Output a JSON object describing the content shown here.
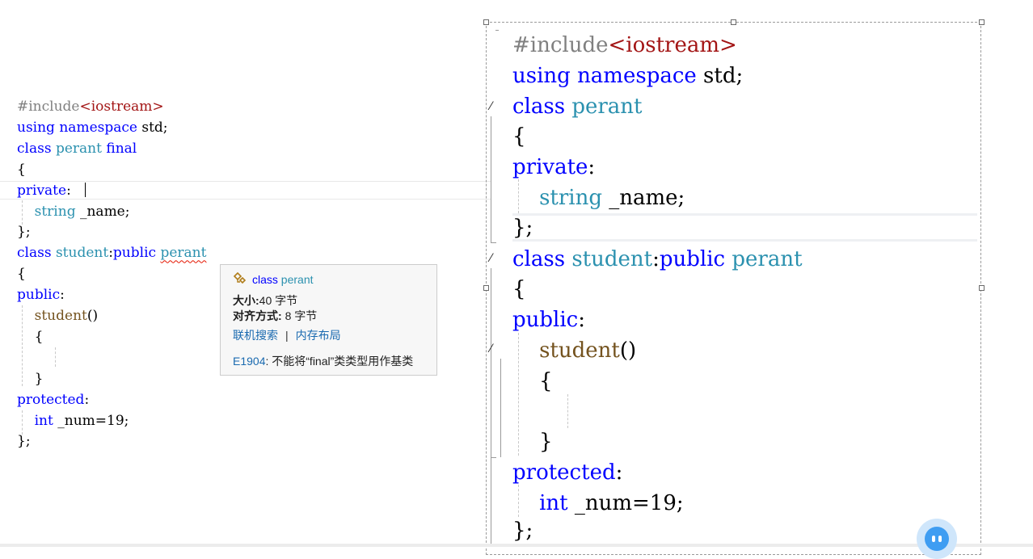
{
  "left_code": [
    {
      "row": 0,
      "tokens": [
        {
          "t": "#include",
          "c": "pp"
        },
        {
          "t": "<iostream>",
          "c": "inc"
        }
      ]
    },
    {
      "row": 1,
      "tokens": [
        {
          "t": "using",
          "c": "kw"
        },
        {
          "t": " ",
          "c": "pl"
        },
        {
          "t": "namespace",
          "c": "kw"
        },
        {
          "t": " std;",
          "c": "pl"
        }
      ]
    },
    {
      "row": 2,
      "tokens": [
        {
          "t": "class",
          "c": "kw"
        },
        {
          "t": " ",
          "c": "pl"
        },
        {
          "t": "perant",
          "c": "ty"
        },
        {
          "t": " ",
          "c": "pl"
        },
        {
          "t": "final",
          "c": "kw"
        }
      ]
    },
    {
      "row": 3,
      "tokens": [
        {
          "t": "{",
          "c": "pl"
        }
      ]
    },
    {
      "row": 4,
      "tokens": [
        {
          "t": "private",
          "c": "kw"
        },
        {
          "t": ":",
          "c": "pl"
        }
      ]
    },
    {
      "row": 5,
      "tokens": [
        {
          "t": "    ",
          "c": "pl"
        },
        {
          "t": "string",
          "c": "ty"
        },
        {
          "t": " _name;",
          "c": "pl"
        }
      ]
    },
    {
      "row": 6,
      "tokens": [
        {
          "t": "};",
          "c": "pl"
        }
      ]
    },
    {
      "row": 7,
      "tokens": [
        {
          "t": "class",
          "c": "kw"
        },
        {
          "t": " ",
          "c": "pl"
        },
        {
          "t": "student",
          "c": "ty"
        },
        {
          "t": ":",
          "c": "pl"
        },
        {
          "t": "public",
          "c": "kw"
        },
        {
          "t": " ",
          "c": "pl"
        },
        {
          "t": "perant",
          "c": "ty",
          "sq": true
        }
      ]
    },
    {
      "row": 8,
      "tokens": [
        {
          "t": "{",
          "c": "pl"
        }
      ]
    },
    {
      "row": 9,
      "tokens": [
        {
          "t": "public",
          "c": "kw"
        },
        {
          "t": ":",
          "c": "pl"
        }
      ]
    },
    {
      "row": 10,
      "tokens": [
        {
          "t": "    ",
          "c": "pl"
        },
        {
          "t": "student",
          "c": "fn"
        },
        {
          "t": "()",
          "c": "pl"
        }
      ]
    },
    {
      "row": 11,
      "tokens": [
        {
          "t": "    {",
          "c": "pl"
        }
      ]
    },
    {
      "row": 12,
      "tokens": [
        {
          "t": "",
          "c": "pl"
        }
      ]
    },
    {
      "row": 13,
      "tokens": [
        {
          "t": "    }",
          "c": "pl"
        }
      ]
    },
    {
      "row": 14,
      "tokens": [
        {
          "t": "protected",
          "c": "kw"
        },
        {
          "t": ":",
          "c": "pl"
        }
      ]
    },
    {
      "row": 15,
      "tokens": [
        {
          "t": "    ",
          "c": "pl"
        },
        {
          "t": "int",
          "c": "kw"
        },
        {
          "t": " _num=19;",
          "c": "pl"
        }
      ]
    },
    {
      "row": 16,
      "tokens": [
        {
          "t": "};",
          "c": "pl"
        }
      ]
    }
  ],
  "right_code": [
    {
      "row": 0,
      "tokens": [
        {
          "t": "#include",
          "c": "pp"
        },
        {
          "t": "<iostream>",
          "c": "inc"
        }
      ]
    },
    {
      "row": 1,
      "tokens": [
        {
          "t": "using",
          "c": "kw"
        },
        {
          "t": " ",
          "c": "pl"
        },
        {
          "t": "namespace",
          "c": "kw"
        },
        {
          "t": " std;",
          "c": "pl"
        }
      ]
    },
    {
      "row": 2,
      "tokens": [
        {
          "t": "class",
          "c": "kw"
        },
        {
          "t": " ",
          "c": "pl"
        },
        {
          "t": "perant",
          "c": "ty"
        }
      ]
    },
    {
      "row": 3,
      "tokens": [
        {
          "t": "{",
          "c": "pl"
        }
      ]
    },
    {
      "row": 4,
      "tokens": [
        {
          "t": "private",
          "c": "kw"
        },
        {
          "t": ":",
          "c": "pl"
        }
      ]
    },
    {
      "row": 5,
      "tokens": [
        {
          "t": "    ",
          "c": "pl"
        },
        {
          "t": "string",
          "c": "ty"
        },
        {
          "t": " _name;",
          "c": "pl"
        }
      ]
    },
    {
      "row": 6,
      "tokens": [
        {
          "t": "};",
          "c": "pl"
        }
      ]
    },
    {
      "row": 7,
      "tokens": [
        {
          "t": "class",
          "c": "kw"
        },
        {
          "t": " ",
          "c": "pl"
        },
        {
          "t": "student",
          "c": "ty"
        },
        {
          "t": ":",
          "c": "pl"
        },
        {
          "t": "public",
          "c": "kw"
        },
        {
          "t": " ",
          "c": "pl"
        },
        {
          "t": "perant",
          "c": "ty"
        }
      ]
    },
    {
      "row": 8,
      "tokens": [
        {
          "t": "{",
          "c": "pl"
        }
      ]
    },
    {
      "row": 9,
      "tokens": [
        {
          "t": "public",
          "c": "kw"
        },
        {
          "t": ":",
          "c": "pl"
        }
      ]
    },
    {
      "row": 10,
      "tokens": [
        {
          "t": "    ",
          "c": "pl"
        },
        {
          "t": "student",
          "c": "fn"
        },
        {
          "t": "()",
          "c": "pl"
        }
      ]
    },
    {
      "row": 11,
      "tokens": [
        {
          "t": "    {",
          "c": "pl"
        }
      ]
    },
    {
      "row": 12,
      "tokens": [
        {
          "t": "",
          "c": "pl"
        }
      ]
    },
    {
      "row": 13,
      "tokens": [
        {
          "t": "    }",
          "c": "pl"
        }
      ]
    },
    {
      "row": 14,
      "tokens": [
        {
          "t": "protected",
          "c": "kw"
        },
        {
          "t": ":",
          "c": "pl"
        }
      ]
    },
    {
      "row": 15,
      "tokens": [
        {
          "t": "    ",
          "c": "pl"
        },
        {
          "t": "int",
          "c": "kw"
        },
        {
          "t": " _num=19;",
          "c": "pl"
        }
      ]
    },
    {
      "row": 16,
      "tokens": [
        {
          "t": "};",
          "c": "pl"
        }
      ]
    }
  ],
  "tooltip": {
    "icon": "class-icon",
    "keyword": "class",
    "name": "perant",
    "size_label": "大小:",
    "size_value": "40 字节",
    "align_label": "对齐方式:",
    "align_value": "8 字节",
    "link_search": "联机搜索",
    "separator": "|",
    "link_layout": "内存布局",
    "error_code": "E1904",
    "error_text": ": 不能将“final”类类型用作基类"
  },
  "assistant": {
    "icon": "assistant-bot-icon"
  },
  "colors": {
    "keyword": "#0000ff",
    "type": "#2b91af",
    "preprocessor": "#808080",
    "include": "#a31515",
    "function": "#74531f",
    "link": "#1a6ab0",
    "squiggle": "#e51400"
  }
}
